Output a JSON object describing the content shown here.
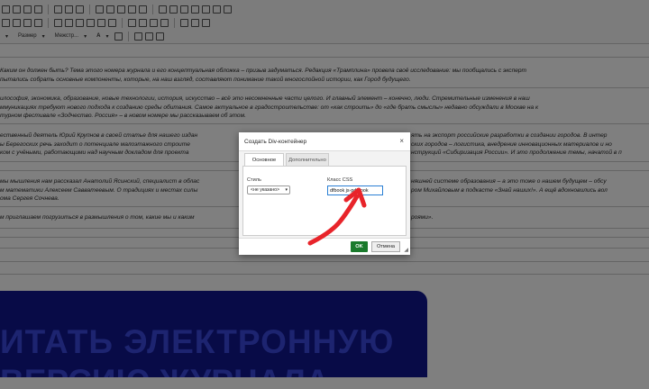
{
  "toolbar": {
    "size_label": "Размер",
    "font_label": "Межстр...",
    "font_color_label": "A"
  },
  "article": {
    "p1_line1": "Каким он должен быть? Тема этого номера журнала и его концептуальная обложка – призыв задуматься. Редакция «Трамплина» провела своё исследование: мы пообщались с эксперт",
    "p1_line2": "пытались собрать основные компоненты, которые, на наш взгляд, составляют понимание такой многослойной истории, как Город будущего.",
    "p2_line1": "илософия, экономика, образование, новые технологии, история, искусство – всё это несомненные части целого. И главный элемент – конечно, люди. Стремительные изменения в наш",
    "p2_line2": "ммуникациях требуют нового подхода к созданию среды обитания. Самое актуальное в градостроительстве: от «как строить» до «где брать смыслы» недавно обсуждали в Москве на к",
    "p2_line3": "турном фестивале «Зодчество. Россия» – в новом номере мы рассказываем об этом.",
    "p3_line1": "ественный деятель Юрий Крупнов в своей статье для нашего издан",
    "p3_line1_end": "ять на экспорт российские разработки в создании городов. В интер",
    "p3_line2": "ы Берегоских речь заходит о потенциале малоэтажного строите",
    "p3_line2_end": "ских городов – логистика, внедрение инновационных материалов и но",
    "p3_line3": "ком с учёными, работающими над научным докладом для проекта",
    "p3_line3_end": "нструкций «Сибиризация России». И это продолжение темы, начатой в п",
    "p4_line1": "мы мышления нам рассказал Анатолий Ясинский, специалист в облас",
    "p4_line1_end": "няшней системе образования – а это тоже о нашем будущем – обсу",
    "p4_line2": "м математики Алексеем Савватеевым. О традициях и местах силы",
    "p4_line2_end": "ром Михайловым в подкасте «Знай наших!». А ещё вдохновились вол",
    "p4_line3": "ома Сергея Сочнева.",
    "p5_line1": "м приглашаем погрузиться в размышления о том, какие мы и каким",
    "p5_line1_end": "роями»."
  },
  "banner": {
    "line1": "ИТАТЬ ЭЛЕКТРОННУЮ",
    "line2": "ВЕРСИЮ ЖУРНАЛА"
  },
  "dialog": {
    "title": "Создать Div-контейнер",
    "close": "×",
    "tab_basic": "Основное",
    "tab_advanced": "Дополнительно",
    "style_label": "Стиль",
    "style_value": "<не указано>",
    "css_class_label": "Класс CSS",
    "css_class_value": "dfbook js-pdfbook",
    "ok_label": "OK",
    "cancel_label": "Отмена"
  },
  "colors": {
    "ok_button": "#1a7a2c",
    "arrow": "#e8242a",
    "input_focus": "#2a7fd4",
    "banner_bg": "#10178f"
  }
}
